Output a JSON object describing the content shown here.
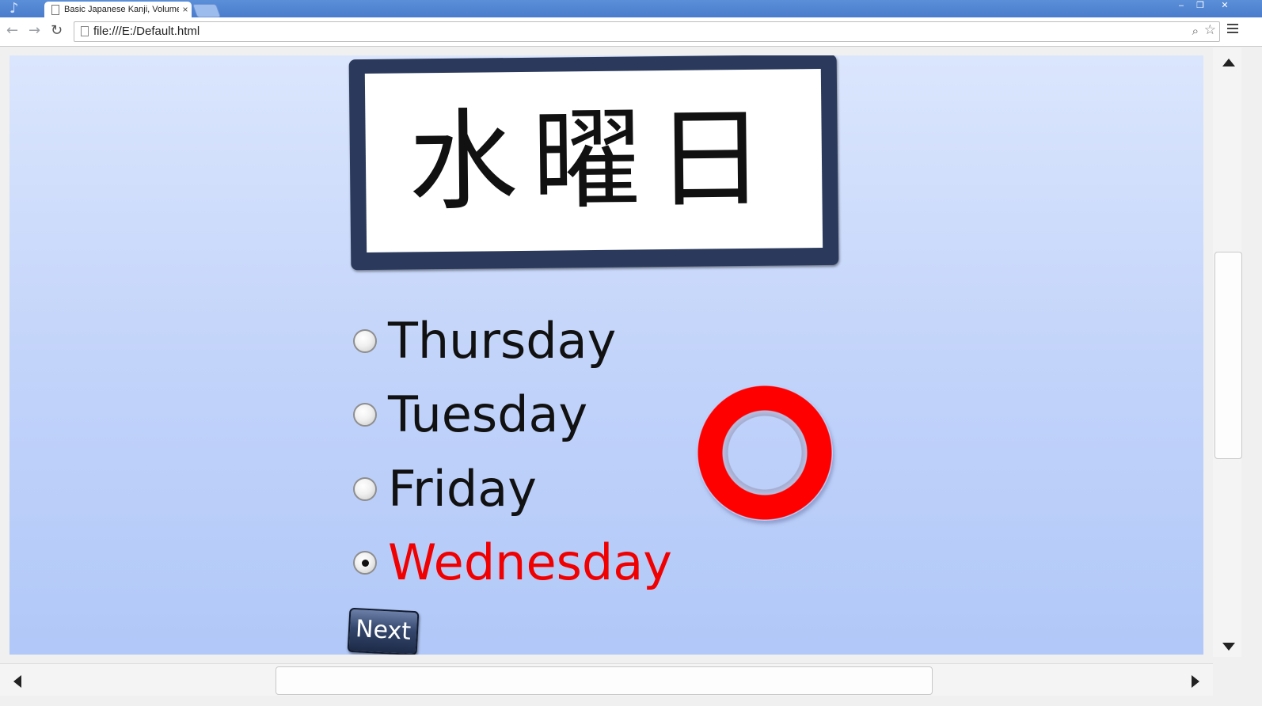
{
  "browser": {
    "tab_title": "Basic Japanese Kanji, Volume",
    "tab_close": "×",
    "url": "file:///E:/Default.html",
    "window_controls": {
      "minimize": "‒",
      "maximize": "❐",
      "close": "✕"
    }
  },
  "quiz": {
    "kanji": "水曜日",
    "options": [
      {
        "label": "Thursday",
        "selected": false
      },
      {
        "label": "Tuesday",
        "selected": false
      },
      {
        "label": "Friday",
        "selected": false
      },
      {
        "label": "Wednesday",
        "selected": true,
        "correct": true
      }
    ],
    "result_mark": "circle-correct",
    "next_label": "Next"
  },
  "colors": {
    "background_top": "#dbe6fd",
    "background_bottom": "#b1c8f8",
    "card_frame": "#2b3a5c",
    "correct_text": "#f00000",
    "correct_mark": "#ff0000"
  }
}
